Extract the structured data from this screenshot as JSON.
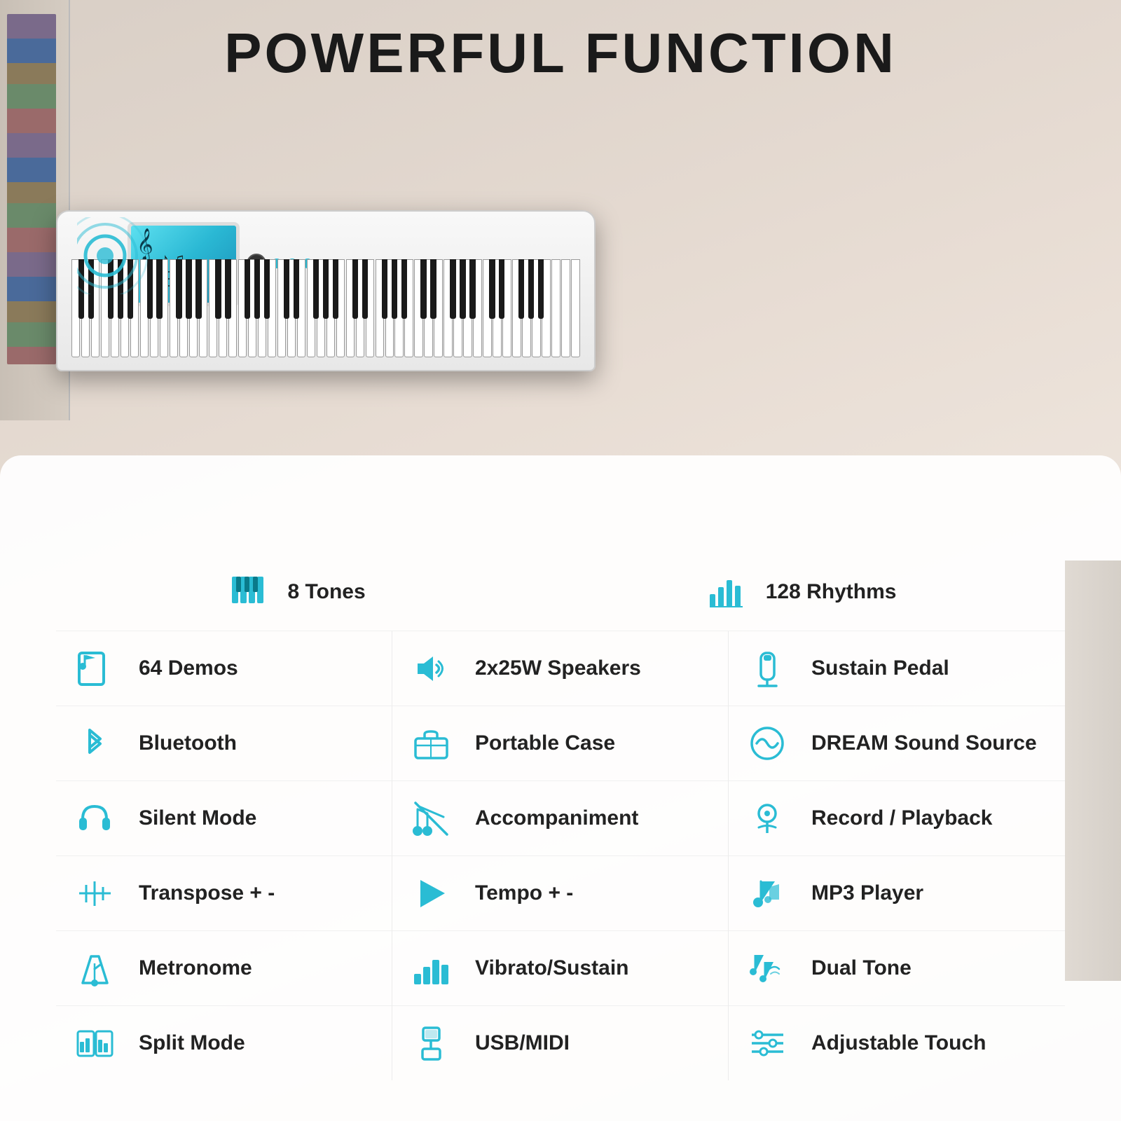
{
  "title": "POWERFUL FUNCTION",
  "accentColor": "#2abcd4",
  "topFeatures": [
    {
      "icon": "piano-keys-icon",
      "label": "8 Tones"
    },
    {
      "icon": "rhythms-icon",
      "label": "128 Rhythms"
    }
  ],
  "columns": [
    {
      "items": [
        {
          "icon": "music-note-icon",
          "label": "64 Demos"
        },
        {
          "icon": "bluetooth-icon",
          "label": "Bluetooth"
        },
        {
          "icon": "headphones-icon",
          "label": "Silent Mode"
        },
        {
          "icon": "transpose-icon",
          "label": "Transpose + -"
        },
        {
          "icon": "metronome-icon",
          "label": "Metronome"
        },
        {
          "icon": "split-icon",
          "label": "Split Mode"
        }
      ]
    },
    {
      "items": [
        {
          "icon": "speaker-icon",
          "label": "2x25W Speakers"
        },
        {
          "icon": "case-icon",
          "label": "Portable Case"
        },
        {
          "icon": "accompaniment-icon",
          "label": "Accompaniment"
        },
        {
          "icon": "tempo-icon",
          "label": "Tempo + -"
        },
        {
          "icon": "vibrato-icon",
          "label": "Vibrato/Sustain"
        },
        {
          "icon": "usb-icon",
          "label": "USB/MIDI"
        }
      ]
    },
    {
      "items": [
        {
          "icon": "pedal-icon",
          "label": "Sustain Pedal"
        },
        {
          "icon": "dream-icon",
          "label": "DREAM Sound Source"
        },
        {
          "icon": "record-icon",
          "label": "Record / Playback"
        },
        {
          "icon": "mp3-icon",
          "label": "MP3 Player"
        },
        {
          "icon": "dual-tone-icon",
          "label": "Dual Tone"
        },
        {
          "icon": "touch-icon",
          "label": "Adjustable Touch"
        }
      ]
    }
  ]
}
